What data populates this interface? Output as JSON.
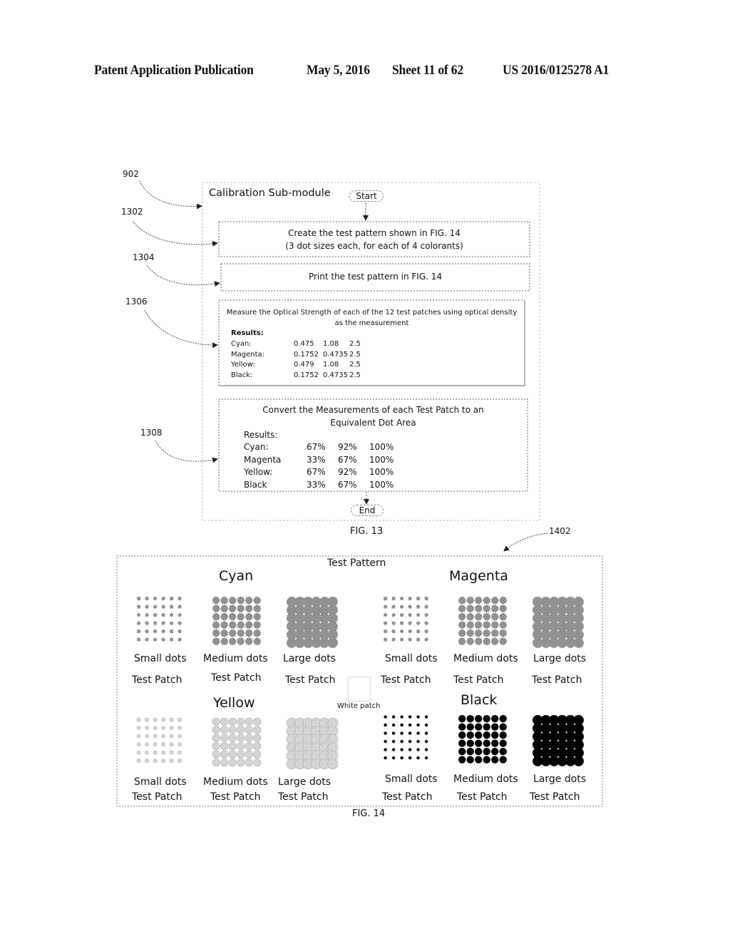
{
  "header": {
    "publication": "Patent Application Publication",
    "date": "May 5, 2016",
    "sheet": "Sheet 11 of 62",
    "number": "US 2016/0125278 A1"
  },
  "fig13": {
    "caption": "FIG. 13",
    "title": "Calibration Sub-module",
    "start_label": "Start",
    "end_label": "End",
    "refs": {
      "module": "902",
      "step1": "1302",
      "step2": "1304",
      "step3": "1306",
      "step4": "1308"
    },
    "step1": {
      "line1": "Create the test pattern shown in FIG. 14",
      "line2": "(3 dot sizes each, for each of 4 colorants)"
    },
    "step2": {
      "text": "Print the test pattern in FIG. 14"
    },
    "step3": {
      "line1": "Measure the Optical Strength of each of the 12 test patches using optical density",
      "line2": "as the measurement",
      "results_label": "Results:",
      "rows": [
        {
          "name": "Cyan:",
          "values": [
            "0.475",
            "1.08",
            "2.5"
          ]
        },
        {
          "name": "Magenta:",
          "values": [
            "0.1752",
            "0.4735",
            "2.5"
          ]
        },
        {
          "name": "Yellow:",
          "values": [
            "0.479",
            "1.08",
            "2.5"
          ]
        },
        {
          "name": "Black:",
          "values": [
            "0.1752",
            "0.4735",
            "2.5"
          ]
        }
      ]
    },
    "step4": {
      "line1": "Convert the Measurements of each Test Patch to an",
      "line2": "Equivalent Dot Area",
      "results_label": "Results:",
      "rows": [
        {
          "name": "Cyan:",
          "values": [
            "67%",
            "92%",
            "100%"
          ]
        },
        {
          "name": "Magenta",
          "values": [
            "33%",
            "67%",
            "100%"
          ]
        },
        {
          "name": "Yellow:",
          "values": [
            "67%",
            "92%",
            "100%"
          ]
        },
        {
          "name": "Black",
          "values": [
            "33%",
            "67%",
            "100%"
          ]
        }
      ]
    }
  },
  "fig14": {
    "caption": "FIG. 14",
    "ref": "1402",
    "title": "Test Pattern",
    "white_patch_label": "White patch",
    "colorants": [
      {
        "name": "Cyan",
        "style": "halftone-dark"
      },
      {
        "name": "Magenta",
        "style": "halftone-dark"
      },
      {
        "name": "Yellow",
        "style": "halftone-light"
      },
      {
        "name": "Black",
        "style": "solid"
      }
    ],
    "patch_sizes": [
      "Small dots",
      "Medium dots",
      "Large dots"
    ],
    "patch_label": "Test Patch",
    "grid": {
      "rows": 6,
      "cols": 6
    }
  }
}
